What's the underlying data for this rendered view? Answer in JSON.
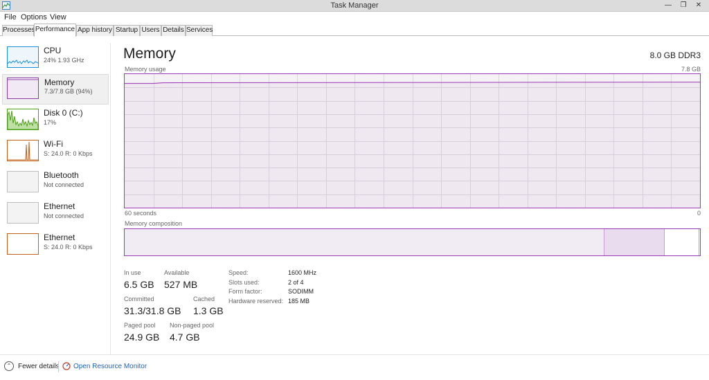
{
  "window": {
    "title": "Task Manager"
  },
  "menu": [
    "File",
    "Options",
    "View"
  ],
  "tabs": [
    {
      "label": "Processes",
      "active": false
    },
    {
      "label": "Performance",
      "active": true
    },
    {
      "label": "App history",
      "active": false
    },
    {
      "label": "Startup",
      "active": false
    },
    {
      "label": "Users",
      "active": false
    },
    {
      "label": "Details",
      "active": false
    },
    {
      "label": "Services",
      "active": false
    }
  ],
  "sidebar": [
    {
      "name": "CPU",
      "sub": "24% 1.93 GHz",
      "color": "#1a8ed6",
      "selected": false
    },
    {
      "name": "Memory",
      "sub": "7.3/7.8 GB (94%)",
      "color": "#8e3aa8",
      "selected": true
    },
    {
      "name": "Disk 0 (C:)",
      "sub": "17%",
      "color": "#4c9e16",
      "selected": false
    },
    {
      "name": "Wi-Fi",
      "sub": "S: 24.0  R: 0 Kbps",
      "color": "#c0601a",
      "selected": false
    },
    {
      "name": "Bluetooth",
      "sub": "Not connected",
      "color": "#bdbdbd",
      "selected": false
    },
    {
      "name": "Ethernet",
      "sub": "Not connected",
      "color": "#bdbdbd",
      "selected": false
    },
    {
      "name": "Ethernet",
      "sub": "S: 24.0  R: 0 Kbps",
      "color": "#c0601a",
      "selected": false
    }
  ],
  "main": {
    "title": "Memory",
    "spec": "8.0 GB DDR3",
    "usage_label": "Memory usage",
    "usage_max": "7.8 GB",
    "time_left": "60 seconds",
    "time_right": "0",
    "composition_label": "Memory composition",
    "usage_fraction": 0.94,
    "composition": {
      "in_use_fraction": 0.834,
      "modified_fraction": 0.105,
      "standby_fraction": 0.06
    }
  },
  "stats": {
    "in_use_label": "In use",
    "in_use": "6.5 GB",
    "available_label": "Available",
    "available": "527 MB",
    "committed_label": "Committed",
    "committed": "31.3/31.8 GB",
    "cached_label": "Cached",
    "cached": "1.3 GB",
    "paged_label": "Paged pool",
    "paged": "24.9 GB",
    "nonpaged_label": "Non-paged pool",
    "nonpaged": "4.7 GB"
  },
  "specs": {
    "speed_label": "Speed:",
    "speed": "1600 MHz",
    "slots_label": "Slots used:",
    "slots": "2 of 4",
    "form_label": "Form factor:",
    "form": "SODIMM",
    "reserved_label": "Hardware reserved:",
    "reserved": "185 MB"
  },
  "footer": {
    "fewer_details": "Fewer details",
    "resource_monitor": "Open Resource Monitor"
  },
  "colors": {
    "accent": "#9c37b5",
    "link": "#1f63b3"
  }
}
